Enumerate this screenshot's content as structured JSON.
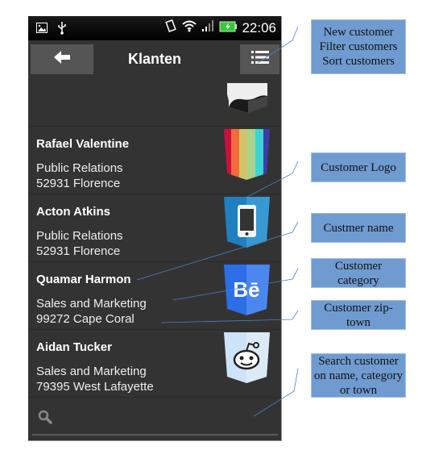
{
  "statusbar": {
    "time": "22:06",
    "icons": [
      "image-icon",
      "usb-icon",
      "vibrate-icon",
      "wifi-icon",
      "signal-icon",
      "battery-charging-icon"
    ]
  },
  "actionbar": {
    "title": "Klanten",
    "back_icon": "arrow-left-icon",
    "menu_icon": "list-menu-icon"
  },
  "customers": [
    {
      "name": "",
      "category": "",
      "town": "",
      "logo": "black-white-logo"
    },
    {
      "name": "Rafael Valentine",
      "category": "Public Relations",
      "town": "52931 Florence",
      "logo": "rainbow-stripes-logo"
    },
    {
      "name": "Acton Atkins",
      "category": "Public Relations",
      "town": "52931 Florence",
      "logo": "smartphone-logo"
    },
    {
      "name": "Quamar Harmon",
      "category": "Sales and Marketing",
      "town": "99272 Cape Coral",
      "logo": "behance-logo"
    },
    {
      "name": "Aidan Tucker",
      "category": "Sales and Marketing",
      "town": "79395 West Lafayette",
      "logo": "reddit-logo"
    }
  ],
  "search": {
    "placeholder": "",
    "icon": "search-icon"
  },
  "annotations": [
    {
      "id": "menu",
      "text": "New customer\nFilter customers\nSort customers"
    },
    {
      "id": "logo",
      "text": "Customer Logo"
    },
    {
      "id": "name",
      "text": "Custmer name"
    },
    {
      "id": "category",
      "text": "Customer category"
    },
    {
      "id": "zip",
      "text": "Customer zip-town"
    },
    {
      "id": "search",
      "text": "Search customer on name, category or town"
    }
  ]
}
